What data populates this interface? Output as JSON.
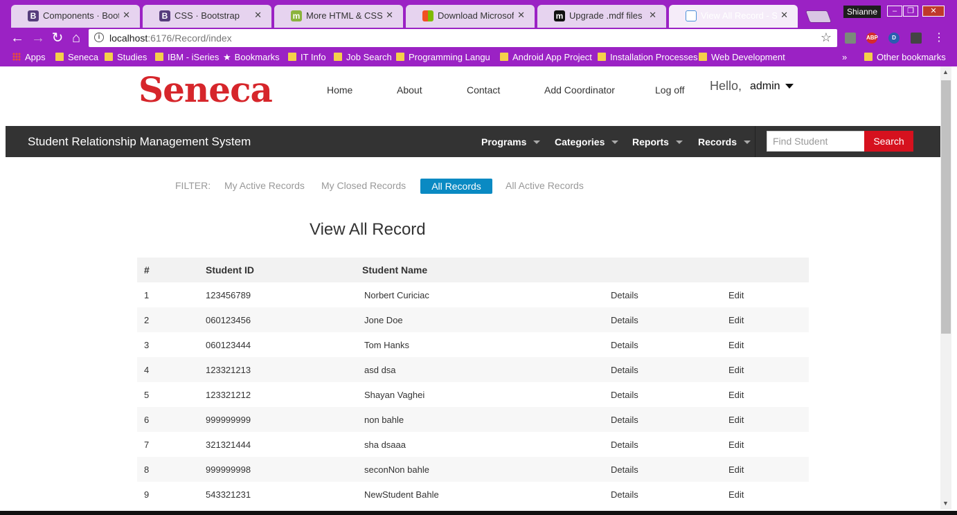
{
  "browser": {
    "tabs": [
      {
        "title": "Components · Bootstrap",
        "favicon": "B",
        "color": "#563d7c",
        "active": false
      },
      {
        "title": "CSS · Bootstrap",
        "favicon": "B",
        "color": "#563d7c",
        "active": false
      },
      {
        "title": "More HTML & CSS: Imag",
        "favicon": "m",
        "color": "#8bb33d",
        "active": false
      },
      {
        "title": "Download Microsoft® S",
        "favicon": "windows-icon",
        "color": "#f25022",
        "active": false
      },
      {
        "title": "Upgrade .mdf files",
        "favicon": "m",
        "color": "#111111",
        "active": false
      },
      {
        "title": "View All Record - Seneca",
        "favicon": "page-icon",
        "color": "#4a90d9",
        "active": true
      }
    ],
    "profile_name": "Shianne",
    "url_host": "localhost",
    "url_path": ":6176/Record/index",
    "bookmarks": [
      "Apps",
      "Seneca",
      "Studies",
      "IBM - iSeries",
      "Bookmarks",
      "IT Info",
      "Job Search",
      "Programming Langua",
      "Android App Project",
      "Installation Processes",
      "Web Development"
    ],
    "bookmarks_overflow": "»",
    "other_bookmarks": "Other bookmarks"
  },
  "site": {
    "logo": "Seneca",
    "top_nav": [
      "Home",
      "About",
      "Contact",
      "Add Coordinator",
      "Log off"
    ],
    "hello": "Hello,",
    "user": "admin",
    "brand": "Student Relationship Management System",
    "menu": [
      "Programs",
      "Categories",
      "Reports",
      "Records"
    ],
    "search_placeholder": "Find Student",
    "search_button": "Search"
  },
  "filter": {
    "label": "FILTER:",
    "options": [
      "My Active Records",
      "My Closed Records",
      "All Records",
      "All Active Records"
    ],
    "selected": "All Records"
  },
  "heading": "View All Record",
  "table": {
    "headers": [
      "#",
      "Student ID",
      "Student Name"
    ],
    "rows": [
      {
        "num": "1",
        "id": "123456789",
        "name": "Norbert Curiciac"
      },
      {
        "num": "2",
        "id": "060123456",
        "name": "Jone Doe"
      },
      {
        "num": "3",
        "id": "060123444",
        "name": "Tom Hanks"
      },
      {
        "num": "4",
        "id": "123321213",
        "name": "asd dsa"
      },
      {
        "num": "5",
        "id": "123321212",
        "name": "Shayan Vaghei"
      },
      {
        "num": "6",
        "id": "999999999",
        "name": "non bahle"
      },
      {
        "num": "7",
        "id": "321321444",
        "name": "sha dsaaa"
      },
      {
        "num": "8",
        "id": "999999998",
        "name": "seconNon bahle"
      },
      {
        "num": "9",
        "id": "543321231",
        "name": "NewStudent Bahle"
      }
    ],
    "details_label": "Details",
    "edit_label": "Edit"
  }
}
